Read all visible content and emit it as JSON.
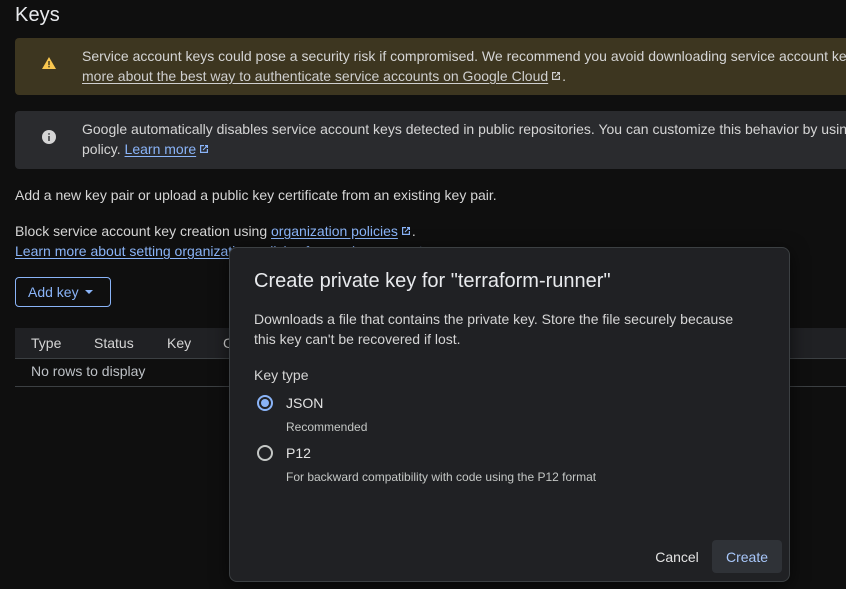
{
  "page": {
    "title": "Keys"
  },
  "warning_banner": {
    "icon": "warning-icon",
    "line1": "Service account keys could pose a security risk if compromised. We recommend you avoid downloading service account ke",
    "link": "more about the best way to authenticate service accounts on Google Cloud",
    "suffix": ".",
    "color": "#3d3620"
  },
  "info_banner": {
    "icon": "info-icon",
    "line1": "Google automatically disables service account keys detected in public repositories. You can customize this behavior by usin",
    "line2_prefix": "policy.",
    "link": "Learn more",
    "color": "#2a2b2e"
  },
  "intro": {
    "text": "Add a new key pair or upload a public key certificate from an existing key pair."
  },
  "block_policy": {
    "prefix": "Block service account key creation using ",
    "link": "organization policies",
    "suffix": ".",
    "learn_more_link": "Learn more about setting organization policies for service accounts"
  },
  "add_key_button": {
    "label": "Add key"
  },
  "table": {
    "columns": [
      "Type",
      "Status",
      "Key",
      "C"
    ],
    "empty_text": "No rows to display"
  },
  "dialog": {
    "title": "Create private key for \"terraform-runner\"",
    "description_line1": "Downloads a file that contains the private key. Store the file securely because",
    "description_line2": "this key can't be recovered if lost.",
    "key_type_label": "Key type",
    "options": [
      {
        "label": "JSON",
        "sub": "Recommended",
        "selected": true
      },
      {
        "label": "P12",
        "sub": "For backward compatibility with code using the P12 format",
        "selected": false
      }
    ],
    "cancel_label": "Cancel",
    "create_label": "Create"
  },
  "colors": {
    "accent": "#8ab4f8",
    "background": "#0f0f0f",
    "dialog_bg": "#202124"
  }
}
